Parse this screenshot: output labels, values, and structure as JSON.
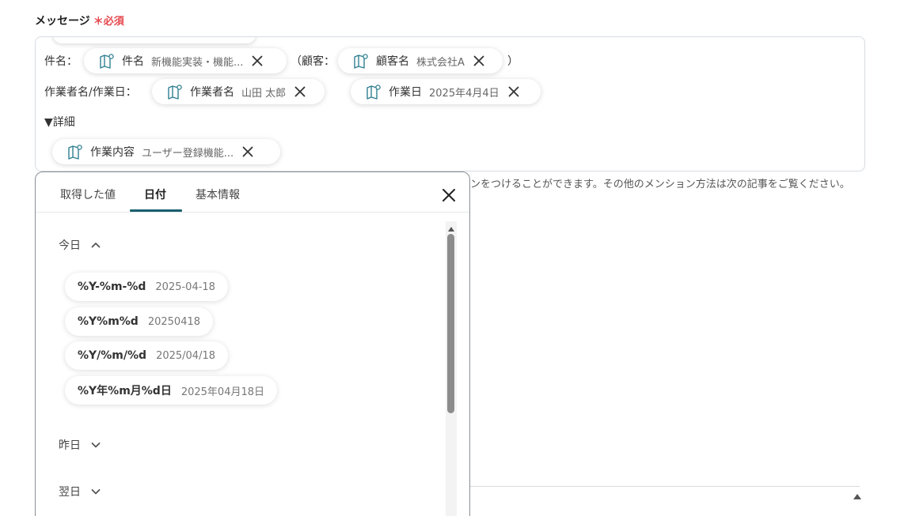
{
  "field": {
    "label": "メッセージ",
    "required_mark": "＊必須"
  },
  "message": {
    "line1_prefix": "件名：",
    "line1_mid": "（顧客：",
    "line1_suffix": "）",
    "line2_prefix": "作業者名/作業日：",
    "line3": "▼詳細",
    "chips": {
      "subject": {
        "name": "件名",
        "value": "新機能実装・機能..."
      },
      "customer": {
        "name": "顧客名",
        "value": "株式会社A"
      },
      "worker": {
        "name": "作業者名",
        "value": "山田 太郎"
      },
      "work_date": {
        "name": "作業日",
        "value": "2025年4月4日"
      },
      "work_content": {
        "name": "作業内容",
        "value": "ユーザー登録機能..."
      }
    }
  },
  "help_text": "ンをつけることができます。その他のメンション方法は次の記事をご覧ください。",
  "picker": {
    "tabs": [
      "取得した値",
      "日付",
      "基本情報"
    ],
    "active_tab": "日付",
    "sections": {
      "today": {
        "label": "今日",
        "expanded": true
      },
      "yesterday": {
        "label": "昨日",
        "expanded": false
      },
      "tomorrow": {
        "label": "翌日",
        "expanded": false
      }
    },
    "formats": [
      {
        "format": "%Y-%m-%d",
        "example": "2025-04-18"
      },
      {
        "format": "%Y%m%d",
        "example": "20250418"
      },
      {
        "format": "%Y/%m/%d",
        "example": "2025/04/18"
      },
      {
        "format": "%Y年%m月%d日",
        "example": "2025年04月18日"
      }
    ]
  },
  "colors": {
    "accent": "#1b5f6e",
    "icon": "#2f7f91",
    "required": "#e5484d"
  },
  "icons": {
    "chip": "book-tag-icon",
    "remove": "close-icon",
    "popup_close": "close-icon",
    "collapse": "chevron-up-icon",
    "expand": "chevron-down-icon"
  }
}
